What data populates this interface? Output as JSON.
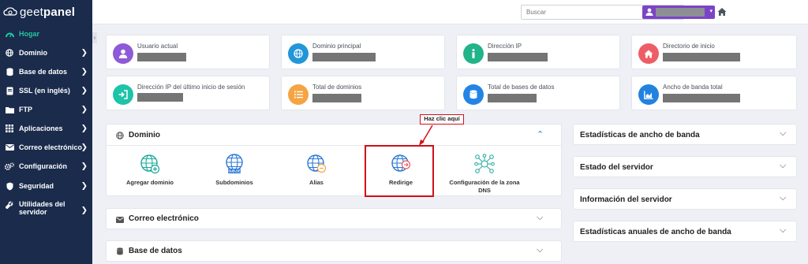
{
  "brand": {
    "name_light": "geet",
    "name_bold": "panel"
  },
  "sidebar": {
    "items": [
      {
        "label": "Hogar",
        "icon": "dashboard-icon",
        "active": true
      },
      {
        "label": "Dominio",
        "icon": "globe-icon"
      },
      {
        "label": "Base de datos",
        "icon": "database-icon"
      },
      {
        "label": "SSL (en inglés)",
        "icon": "ssl-icon"
      },
      {
        "label": "FTP",
        "icon": "folder-icon"
      },
      {
        "label": "Aplicaciones",
        "icon": "grid-icon"
      },
      {
        "label": "Correo electrónico",
        "icon": "envelope-icon"
      },
      {
        "label": "Configuración",
        "icon": "gears-icon"
      },
      {
        "label": "Seguridad",
        "icon": "shield-icon"
      },
      {
        "label": "Utilidades del servidor",
        "icon": "wrench-icon"
      }
    ]
  },
  "topbar": {
    "search_placeholder": "Buscar",
    "icons": [
      "wordpress-icon",
      "home-icon",
      "user-icon"
    ]
  },
  "stats": [
    {
      "label": "Usuario actual",
      "color": "#8e5ad8",
      "icon": "user-icon"
    },
    {
      "label": "Dominio principal",
      "color": "#2196d9",
      "icon": "globe-icon"
    },
    {
      "label": "Dirección IP",
      "color": "#21b38a",
      "icon": "info-icon"
    },
    {
      "label": "Directorio de inicio",
      "color": "#ee5d66",
      "icon": "home-icon"
    },
    {
      "label": "Dirección IP del último inicio de sesión",
      "color": "#1ec3a8",
      "icon": "login-icon"
    },
    {
      "label": "Total de dominios",
      "color": "#f5a443",
      "icon": "list-icon"
    },
    {
      "label": "Total de bases de datos",
      "color": "#2384e6",
      "icon": "database-icon"
    },
    {
      "label": "Ancho de banda total",
      "color": "#2282e0",
      "icon": "chart-icon"
    }
  ],
  "domain_panel": {
    "title": "Dominio",
    "tiles": [
      {
        "label": "Agregar dominio",
        "icon": "globe-plus-icon"
      },
      {
        "label": "Subdominios",
        "icon": "globe-subdomain-icon",
        "badge": "SUB.DE"
      },
      {
        "label": "Alias",
        "icon": "globe-alias-icon"
      },
      {
        "label": "Redirige",
        "icon": "globe-redirect-icon"
      },
      {
        "label": "Configuración de la zona DNS",
        "icon": "dns-network-icon"
      }
    ]
  },
  "email_panel": {
    "title": "Correo electrónico"
  },
  "database_panel": {
    "title": "Base de datos"
  },
  "callout": {
    "text": "Haz clic aquí"
  },
  "right_panels": [
    {
      "title": "Estadísticas de ancho de banda"
    },
    {
      "title": "Estado del servidor"
    },
    {
      "title": "Información del servidor"
    },
    {
      "title": "Estadísticas anuales de ancho de banda"
    }
  ],
  "colors": {
    "sidebar": "#1a2b4c",
    "accent_active": "#21c8a0",
    "user_button": "#7b44c7",
    "highlight": "#d0101a",
    "icon_teal": "#1aa89b"
  }
}
